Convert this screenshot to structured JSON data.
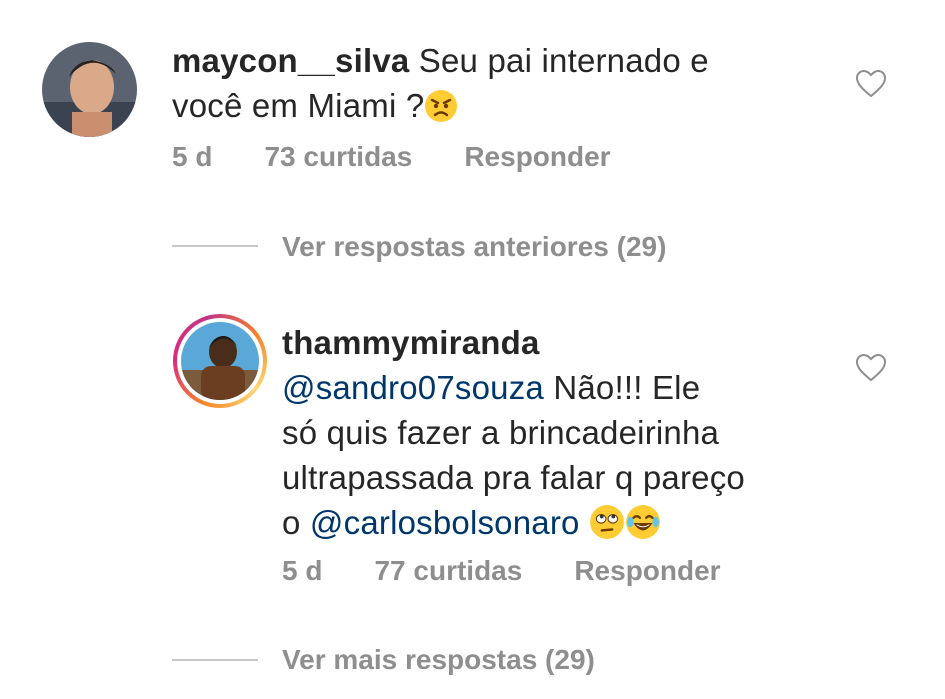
{
  "comments": [
    {
      "username": "maycon__silva",
      "text_line1": "Seu pai internado e",
      "text_line2": "você em Miami ?",
      "emoji": "angry-face",
      "time": "5 d",
      "likes": "73 curtidas",
      "reply": "Responder"
    },
    {
      "username": "thammymiranda",
      "mention1": "@sandro07souza",
      "text_a": " Não!!! Ele",
      "text_line2": "só quis fazer a brincadeirinha",
      "text_line3": "ultrapassada pra falar q pareço",
      "text_line4_prefix": "o ",
      "mention2": "@carlosbolsonaro",
      "emojis": [
        "eye-roll-face",
        "tears-of-joy-face"
      ],
      "time": "5 d",
      "likes": "77 curtidas",
      "reply": "Responder"
    }
  ],
  "view_previous": "Ver respostas anteriores (29)",
  "view_more": "Ver mais respostas (29)",
  "colors": {
    "primary_text": "#262626",
    "secondary_text": "#8e8e8e",
    "mention": "#00376b",
    "emoji_yellow": "#ffcc33"
  }
}
